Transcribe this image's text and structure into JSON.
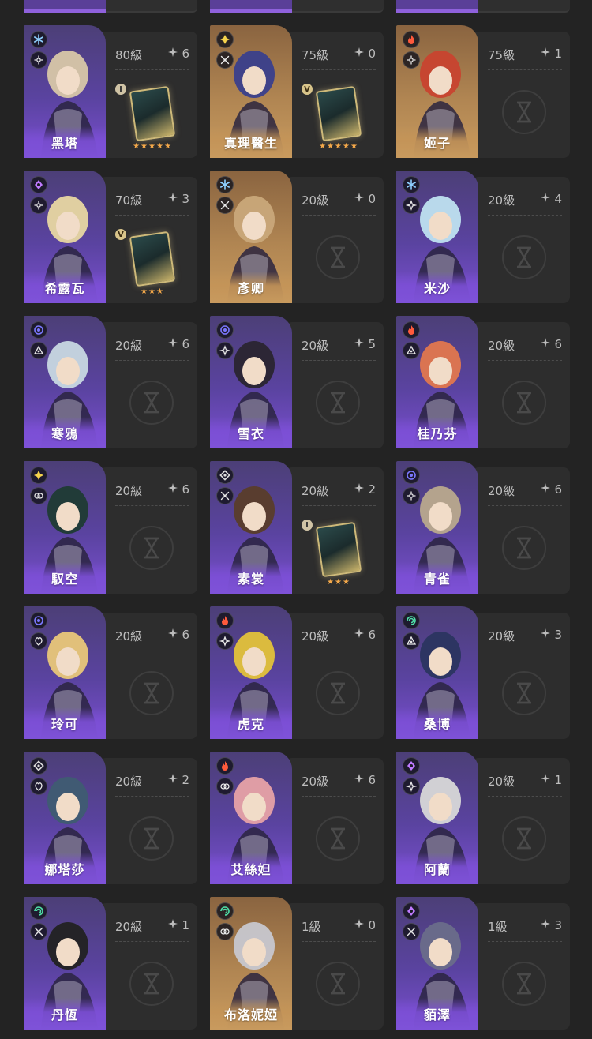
{
  "colors": {
    "background": "#232323",
    "panel": "#2d2d2d",
    "rarity4_portrait": "#7e52d8",
    "rarity5_portrait": "#c89a5e",
    "star_color": "#f3a84a",
    "text_muted": "#bdbdbd"
  },
  "eidolon_icon": "four-point-star-icon",
  "empty_lightcone_icon": "hourglass-icon",
  "characters": [
    {
      "name": "黑塔",
      "level": "80級",
      "eidolon": "6",
      "element": "ice-icon",
      "path": "erudition-icon",
      "rarity": 4,
      "lightcone": {
        "superimposition": "I",
        "stars": "★★★★★"
      }
    },
    {
      "name": "真理醫生",
      "level": "75級",
      "eidolon": "0",
      "element": "imaginary-icon",
      "path": "hunt-icon",
      "rarity": 5,
      "lightcone": {
        "superimposition": "V",
        "stars": "★★★★★"
      }
    },
    {
      "name": "姬子",
      "level": "75級",
      "eidolon": "1",
      "element": "fire-icon",
      "path": "erudition-icon",
      "rarity": 5,
      "lightcone": null
    },
    {
      "name": "希露瓦",
      "level": "70級",
      "eidolon": "3",
      "element": "lightning-icon",
      "path": "erudition-icon",
      "rarity": 4,
      "lightcone": {
        "superimposition": "V",
        "stars": "★★★"
      }
    },
    {
      "name": "彥卿",
      "level": "20級",
      "eidolon": "0",
      "element": "ice-icon",
      "path": "hunt-icon",
      "rarity": 5,
      "lightcone": null
    },
    {
      "name": "米沙",
      "level": "20級",
      "eidolon": "4",
      "element": "ice-icon",
      "path": "destruction-icon",
      "rarity": 4,
      "lightcone": null
    },
    {
      "name": "寒鴉",
      "level": "20級",
      "eidolon": "6",
      "element": "quantum-icon",
      "path": "nihility-icon",
      "rarity": 4,
      "lightcone": null
    },
    {
      "name": "雪衣",
      "level": "20級",
      "eidolon": "5",
      "element": "quantum-icon",
      "path": "destruction-icon",
      "rarity": 4,
      "lightcone": null
    },
    {
      "name": "桂乃芬",
      "level": "20級",
      "eidolon": "6",
      "element": "fire-icon",
      "path": "nihility-icon",
      "rarity": 4,
      "lightcone": null
    },
    {
      "name": "馭空",
      "level": "20級",
      "eidolon": "6",
      "element": "imaginary-icon",
      "path": "harmony-icon",
      "rarity": 4,
      "lightcone": null
    },
    {
      "name": "素裳",
      "level": "20級",
      "eidolon": "2",
      "element": "physical-icon",
      "path": "hunt-icon",
      "rarity": 4,
      "lightcone": {
        "superimposition": "I",
        "stars": "★★★"
      }
    },
    {
      "name": "青雀",
      "level": "20級",
      "eidolon": "6",
      "element": "quantum-icon",
      "path": "erudition-icon",
      "rarity": 4,
      "lightcone": null
    },
    {
      "name": "玲可",
      "level": "20級",
      "eidolon": "6",
      "element": "quantum-icon",
      "path": "abundance-icon",
      "rarity": 4,
      "lightcone": null
    },
    {
      "name": "虎克",
      "level": "20級",
      "eidolon": "6",
      "element": "fire-icon",
      "path": "destruction-icon",
      "rarity": 4,
      "lightcone": null
    },
    {
      "name": "桑博",
      "level": "20級",
      "eidolon": "3",
      "element": "wind-icon",
      "path": "nihility-icon",
      "rarity": 4,
      "lightcone": null
    },
    {
      "name": "娜塔莎",
      "level": "20級",
      "eidolon": "2",
      "element": "physical-icon",
      "path": "abundance-icon",
      "rarity": 4,
      "lightcone": null
    },
    {
      "name": "艾絲妲",
      "level": "20級",
      "eidolon": "6",
      "element": "fire-icon",
      "path": "harmony-icon",
      "rarity": 4,
      "lightcone": null
    },
    {
      "name": "阿蘭",
      "level": "20級",
      "eidolon": "1",
      "element": "lightning-icon",
      "path": "destruction-icon",
      "rarity": 4,
      "lightcone": null
    },
    {
      "name": "丹恆",
      "level": "20級",
      "eidolon": "1",
      "element": "wind-icon",
      "path": "hunt-icon",
      "rarity": 4,
      "lightcone": null
    },
    {
      "name": "布洛妮婭",
      "level": "1級",
      "eidolon": "0",
      "element": "wind-icon",
      "path": "harmony-icon",
      "rarity": 5,
      "lightcone": null
    },
    {
      "name": "貊澤",
      "level": "1級",
      "eidolon": "3",
      "element": "lightning-icon",
      "path": "hunt-icon",
      "rarity": 4,
      "lightcone": null
    }
  ]
}
